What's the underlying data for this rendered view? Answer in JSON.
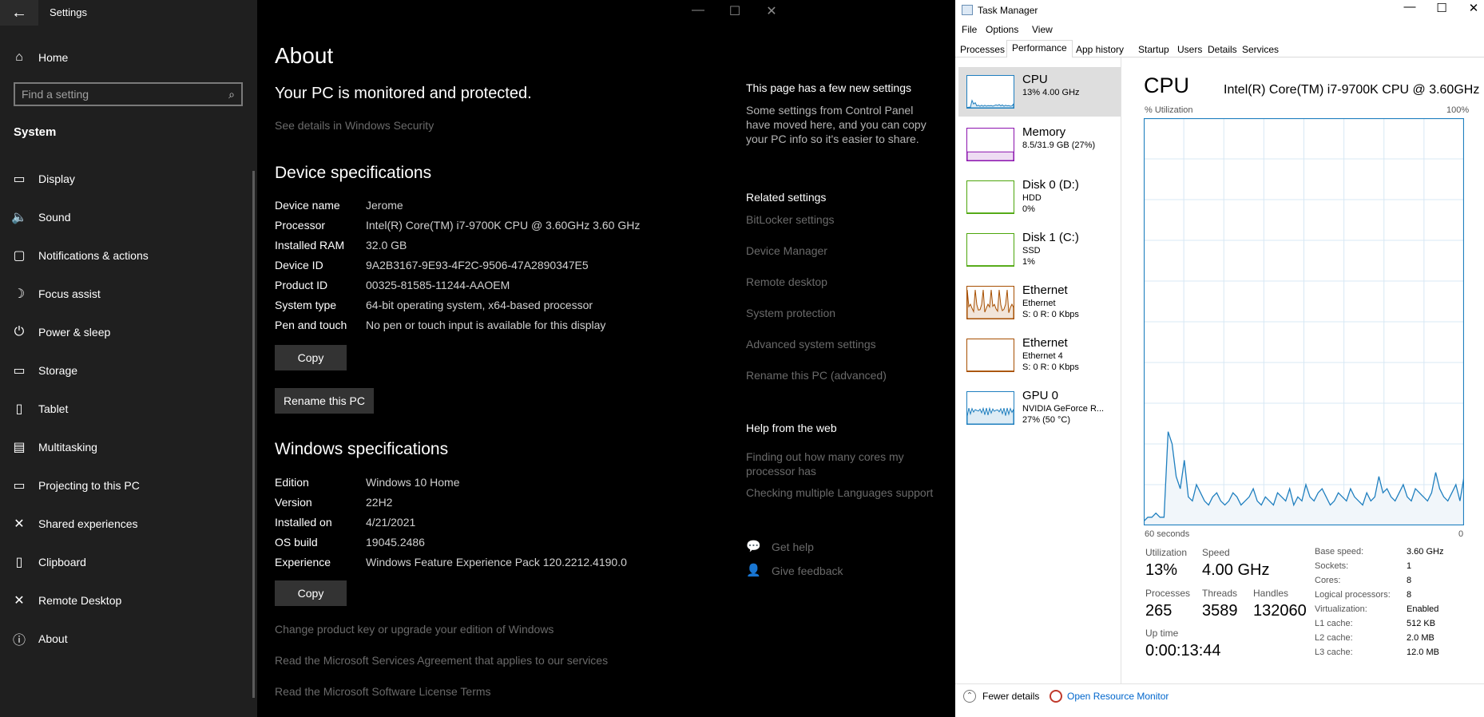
{
  "settings": {
    "window_title": "Settings",
    "home_label": "Home",
    "search_placeholder": "Find a setting",
    "section_label": "System",
    "nav": [
      {
        "icon": "display-icon",
        "glyph": "▭",
        "label": "Display"
      },
      {
        "icon": "sound-icon",
        "glyph": "🔈",
        "label": "Sound"
      },
      {
        "icon": "notifications-icon",
        "glyph": "▢",
        "label": "Notifications & actions"
      },
      {
        "icon": "focus-assist-icon",
        "glyph": "☽",
        "label": "Focus assist"
      },
      {
        "icon": "power-icon",
        "glyph": "⏻",
        "label": "Power & sleep"
      },
      {
        "icon": "storage-icon",
        "glyph": "▭",
        "label": "Storage"
      },
      {
        "icon": "tablet-icon",
        "glyph": "▯",
        "label": "Tablet"
      },
      {
        "icon": "multitasking-icon",
        "glyph": "▤",
        "label": "Multitasking"
      },
      {
        "icon": "projecting-icon",
        "glyph": "▭",
        "label": "Projecting to this PC"
      },
      {
        "icon": "shared-experiences-icon",
        "glyph": "✕",
        "label": "Shared experiences"
      },
      {
        "icon": "clipboard-icon",
        "glyph": "▯",
        "label": "Clipboard"
      },
      {
        "icon": "remote-desktop-icon",
        "glyph": "✕",
        "label": "Remote Desktop"
      },
      {
        "icon": "about-icon",
        "glyph": "ⓘ",
        "label": "About"
      }
    ],
    "about": {
      "title": "About",
      "protection": "Your PC is monitored and protected.",
      "see_details": "See details in Windows Security",
      "device_heading": "Device specifications",
      "device_specs": [
        {
          "k": "Device name",
          "v": "Jerome"
        },
        {
          "k": "Processor",
          "v": "Intel(R) Core(TM) i7-9700K CPU @ 3.60GHz   3.60 GHz"
        },
        {
          "k": "Installed RAM",
          "v": "32.0 GB"
        },
        {
          "k": "Device ID",
          "v": "9A2B3167-9E93-4F2C-9506-47A2890347E5"
        },
        {
          "k": "Product ID",
          "v": "00325-81585-11244-AAOEM"
        },
        {
          "k": "System type",
          "v": "64-bit operating system, x64-based processor"
        },
        {
          "k": "Pen and touch",
          "v": "No pen or touch input is available for this display"
        }
      ],
      "copy_label": "Copy",
      "rename_label": "Rename this PC",
      "windows_heading": "Windows specifications",
      "windows_specs": [
        {
          "k": "Edition",
          "v": "Windows 10 Home"
        },
        {
          "k": "Version",
          "v": "22H2"
        },
        {
          "k": "Installed on",
          "v": "4/21/2021"
        },
        {
          "k": "OS build",
          "v": "19045.2486"
        },
        {
          "k": "Experience",
          "v": "Windows Feature Experience Pack 120.2212.4190.0"
        }
      ],
      "copy2_label": "Copy",
      "links": [
        "Change product key or upgrade your edition of Windows",
        "Read the Microsoft Services Agreement that applies to our services",
        "Read the Microsoft Software License Terms"
      ]
    },
    "right": {
      "new_settings_heading": "This page has a few new settings",
      "new_settings_text": "Some settings from Control Panel have moved here, and you can copy your PC info so it's easier to share.",
      "related_heading": "Related settings",
      "related": [
        "BitLocker settings",
        "Device Manager",
        "Remote desktop",
        "System protection",
        "Advanced system settings",
        "Rename this PC (advanced)"
      ],
      "help_heading": "Help from the web",
      "help_links": [
        "Finding out how many cores my processor has",
        "Checking multiple Languages support"
      ],
      "get_help": "Get help",
      "give_feedback": "Give feedback"
    }
  },
  "taskmgr": {
    "title": "Task Manager",
    "menu": [
      "File",
      "Options",
      "View"
    ],
    "tabs": [
      "Processes",
      "Performance",
      "App history",
      "Startup",
      "Users",
      "Details",
      "Services"
    ],
    "selected_tab": "Performance",
    "resources": [
      {
        "name": "CPU",
        "sub1": "13%  4.00 GHz",
        "sub2": "",
        "color": "#1f7fbf",
        "selected": true
      },
      {
        "name": "Memory",
        "sub1": "8.5/31.9 GB (27%)",
        "sub2": "",
        "color": "#8b12ae",
        "selected": false
      },
      {
        "name": "Disk 0 (D:)",
        "sub1": "HDD",
        "sub2": "0%",
        "color": "#4da60c",
        "selected": false
      },
      {
        "name": "Disk 1 (C:)",
        "sub1": "SSD",
        "sub2": "1%",
        "color": "#4da60c",
        "selected": false
      },
      {
        "name": "Ethernet",
        "sub1": "Ethernet",
        "sub2": "S: 0  R: 0 Kbps",
        "color": "#a74f01",
        "selected": false
      },
      {
        "name": "Ethernet",
        "sub1": "Ethernet 4",
        "sub2": "S: 0  R: 0 Kbps",
        "color": "#a74f01",
        "selected": false
      },
      {
        "name": "GPU 0",
        "sub1": "NVIDIA GeForce R...",
        "sub2": "27%  (50 °C)",
        "color": "#1f7fbf",
        "selected": false
      }
    ],
    "cpu": {
      "heading": "CPU",
      "model": "Intel(R) Core(TM) i7-9700K CPU @ 3.60GHz",
      "util_label": "% Utilization",
      "max_label": "100%",
      "time_label": "60 seconds",
      "zero_label": "0",
      "history": [
        1,
        2,
        2,
        3,
        2,
        2,
        23,
        20,
        12,
        9,
        16,
        7,
        6,
        10,
        8,
        6,
        5,
        7,
        8,
        6,
        5,
        6,
        8,
        7,
        5,
        6,
        7,
        9,
        6,
        5,
        7,
        6,
        5,
        8,
        7,
        6,
        9,
        5,
        7,
        6,
        10,
        7,
        6,
        8,
        9,
        7,
        5,
        6,
        8,
        7,
        6,
        9,
        7,
        6,
        5,
        8,
        6,
        7,
        12,
        8,
        9,
        7,
        6,
        8,
        10,
        7,
        6,
        9,
        8,
        7,
        6,
        8,
        13,
        9,
        7,
        6,
        8,
        10,
        6,
        12
      ],
      "stats": {
        "utilization_label": "Utilization",
        "utilization": "13%",
        "speed_label": "Speed",
        "speed": "4.00 GHz",
        "processes_label": "Processes",
        "processes": "265",
        "threads_label": "Threads",
        "threads": "3589",
        "handles_label": "Handles",
        "handles": "132060",
        "uptime_label": "Up time",
        "uptime": "0:00:13:44"
      },
      "details": [
        {
          "k": "Base speed:",
          "v": "3.60 GHz"
        },
        {
          "k": "Sockets:",
          "v": "1"
        },
        {
          "k": "Cores:",
          "v": "8"
        },
        {
          "k": "Logical processors:",
          "v": "8"
        },
        {
          "k": "Virtualization:",
          "v": "Enabled"
        },
        {
          "k": "L1 cache:",
          "v": "512 KB"
        },
        {
          "k": "L2 cache:",
          "v": "2.0 MB"
        },
        {
          "k": "L3 cache:",
          "v": "12.0 MB"
        }
      ]
    },
    "footer": {
      "fewer_details": "Fewer details",
      "open_resource_monitor": "Open Resource Monitor"
    }
  }
}
